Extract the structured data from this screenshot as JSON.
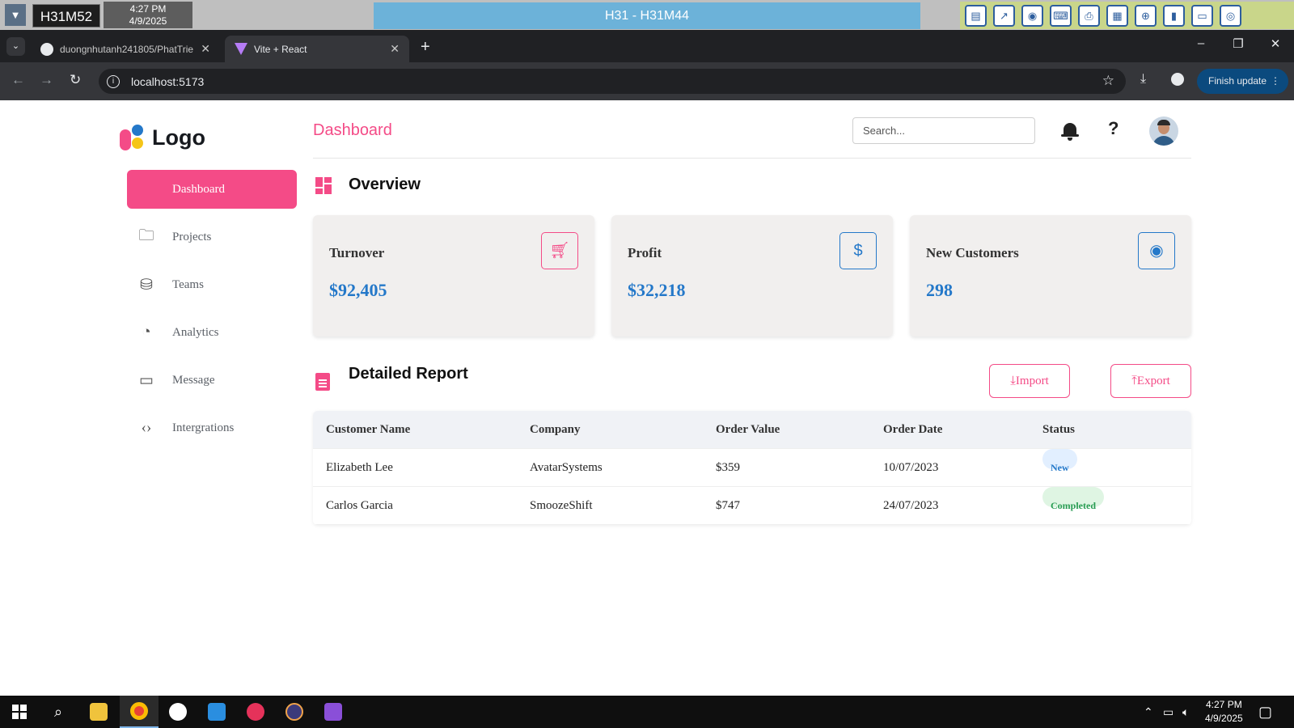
{
  "remote": {
    "host": "H31M52",
    "time": "4:27 PM",
    "date": "4/9/2025",
    "session_title": "H31 - H31M44"
  },
  "browser": {
    "tabs": [
      {
        "title": "duongnhutanh241805/PhatTrie",
        "icon": "github-icon",
        "active": false
      },
      {
        "title": "Vite + React",
        "icon": "vite-icon",
        "active": true
      }
    ],
    "url": "localhost:5173",
    "finish_update_label": "Finish update"
  },
  "app": {
    "logo_text": "Logo",
    "page_title": "Dashboard",
    "search_placeholder": "Search...",
    "sidebar": [
      {
        "label": "Dashboard",
        "icon": "dashboard-icon",
        "active": true
      },
      {
        "label": "Projects",
        "icon": "folder-icon",
        "active": false
      },
      {
        "label": "Teams",
        "icon": "teams-icon",
        "active": false
      },
      {
        "label": "Analytics",
        "icon": "pie-chart-icon",
        "active": false
      },
      {
        "label": "Message",
        "icon": "message-icon",
        "active": false
      },
      {
        "label": "Intergrations",
        "icon": "code-icon",
        "active": false
      }
    ],
    "overview_title": "Overview",
    "cards": [
      {
        "label": "Turnover",
        "value": "$92,405",
        "icon": "cart-icon",
        "accent": "#f44b87"
      },
      {
        "label": "Profit",
        "value": "$32,218",
        "icon": "dollar-icon",
        "accent": "#2478c9"
      },
      {
        "label": "New Customers",
        "value": "298",
        "icon": "user-circle-icon",
        "accent": "#2478c9"
      }
    ],
    "report_title": "Detailed Report",
    "import_label": "Import",
    "export_label": "Export",
    "table": {
      "headers": [
        "Customer Name",
        "Company",
        "Order Value",
        "Order Date",
        "Status"
      ],
      "rows": [
        [
          "Elizabeth Lee",
          "AvatarSystems",
          "$359",
          "10/07/2023",
          "New"
        ],
        [
          "Carlos Garcia",
          "SmoozeShift",
          "$747",
          "24/07/2023",
          "Completed"
        ]
      ]
    },
    "colors": {
      "accent_pink": "#f44b87",
      "accent_blue": "#2478c9"
    }
  },
  "taskbar": {
    "time": "4:27 PM",
    "date": "4/9/2025"
  }
}
